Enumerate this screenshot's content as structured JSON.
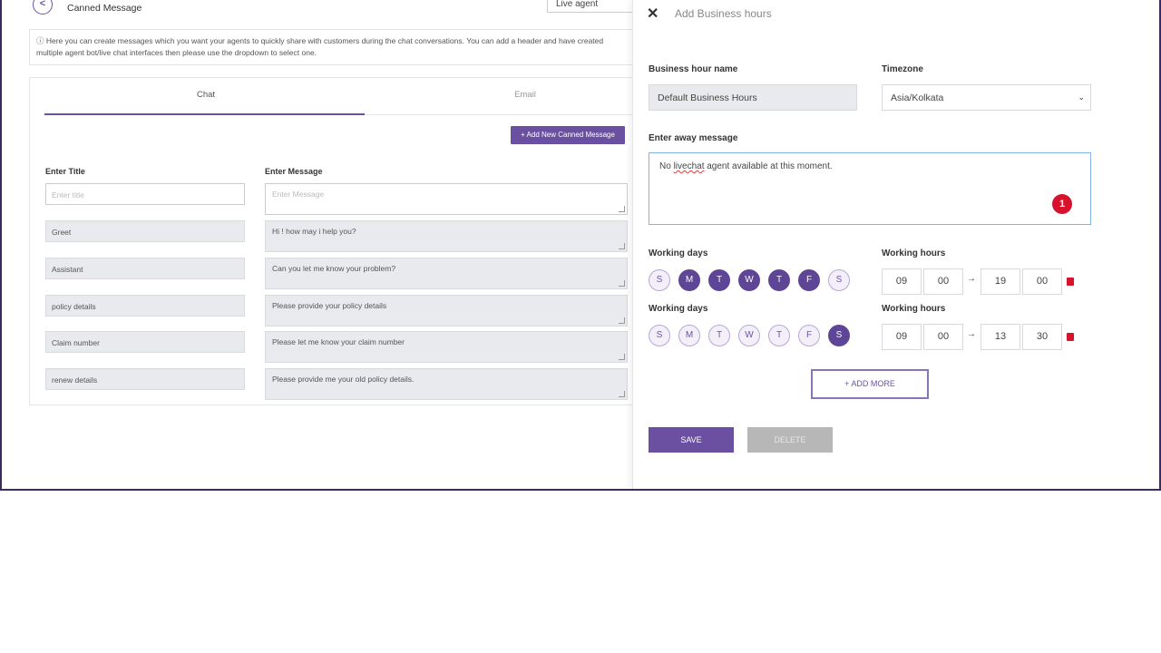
{
  "background_page": {
    "title": "Canned Message",
    "back_icon": "circle-chevron-left-icon",
    "agent_select": "Live agent",
    "info_text": "ⓘ Here you can create messages which you want your agents to quickly share with customers during the chat conversations. You can add a header and have created multiple agent bot/live chat interfaces then please use the dropdown to select one.",
    "tabs": [
      "Chat",
      "Email"
    ],
    "add_button": "+ Add New Canned Message",
    "col_title": "Enter Title",
    "col_message": "Enter Message",
    "title_placeholder": "Enter title",
    "message_placeholder": "Enter Message",
    "rows": [
      {
        "title": "Greet",
        "message": "Hi ! how may i help you?"
      },
      {
        "title": "Assistant",
        "message": "Can you let me know your problem?"
      },
      {
        "title": "policy details",
        "message": "Please provide your policy details"
      },
      {
        "title": "Claim number",
        "message": "Please let me know your claim number"
      },
      {
        "title": "renew details",
        "message": "Please provide me your old policy details."
      }
    ]
  },
  "panel": {
    "title": "Add Business hours",
    "close_icon": "close-x-icon",
    "name_label": "Business hour name",
    "name_value": "Default Business Hours",
    "timezone_label": "Timezone",
    "timezone_value": "Asia/Kolkata",
    "away_label": "Enter away message",
    "away_pre": "No ",
    "away_misspelled": "livechat",
    "away_post": " agent available at this moment.",
    "badge": "1",
    "days_label": "Working days",
    "hours_label": "Working hours",
    "schedules": [
      {
        "days": [
          {
            "letter": "S",
            "on": false
          },
          {
            "letter": "M",
            "on": true
          },
          {
            "letter": "T",
            "on": true
          },
          {
            "letter": "W",
            "on": true
          },
          {
            "letter": "T",
            "on": true
          },
          {
            "letter": "F",
            "on": true
          },
          {
            "letter": "S",
            "on": false
          }
        ],
        "start_h": "09",
        "start_m": "00",
        "end_h": "19",
        "end_m": "00"
      },
      {
        "days": [
          {
            "letter": "S",
            "on": false
          },
          {
            "letter": "M",
            "on": false
          },
          {
            "letter": "T",
            "on": false
          },
          {
            "letter": "W",
            "on": false
          },
          {
            "letter": "T",
            "on": false
          },
          {
            "letter": "F",
            "on": false
          },
          {
            "letter": "S",
            "on": true
          }
        ],
        "start_h": "09",
        "start_m": "00",
        "end_h": "13",
        "end_m": "30"
      }
    ],
    "arrow": "→",
    "add_more": "+ ADD MORE",
    "save": "SAVE",
    "delete": "DELETE"
  },
  "colors": {
    "accent": "#6b4fa0",
    "badge": "#d6122d"
  }
}
